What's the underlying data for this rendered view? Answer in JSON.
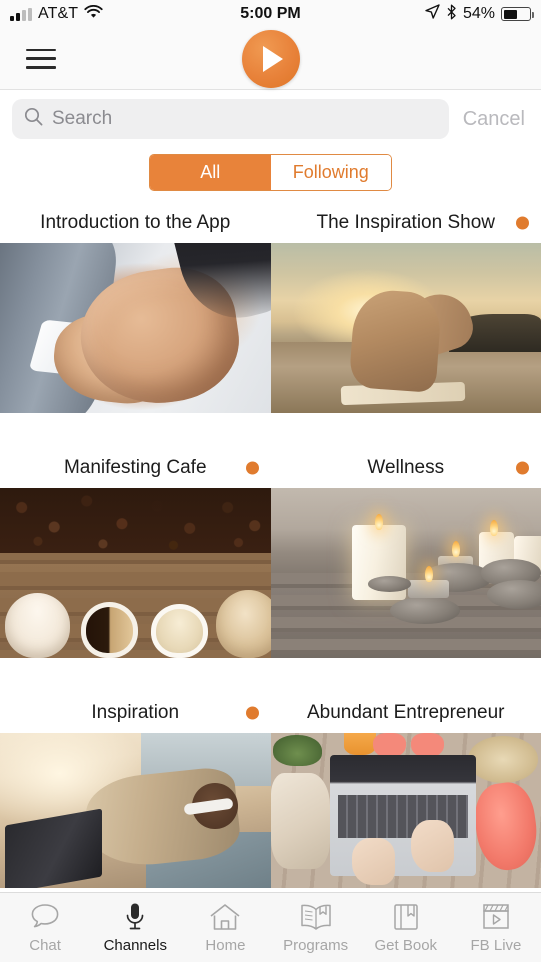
{
  "status_bar": {
    "carrier": "AT&T",
    "time": "5:00 PM",
    "battery_percent": "54%",
    "battery_level": 54,
    "icons": [
      "signal-bars-icon",
      "wifi-icon",
      "location-arrow-icon",
      "bluetooth-icon",
      "battery-icon"
    ]
  },
  "nav": {
    "menu_icon": "hamburger-menu-icon",
    "play_icon": "play-icon"
  },
  "search": {
    "placeholder": "Search",
    "value": "",
    "icon": "search-icon",
    "cancel_label": "Cancel"
  },
  "segmented": {
    "options": [
      {
        "label": "All",
        "selected": true
      },
      {
        "label": "Following",
        "selected": false
      }
    ]
  },
  "colors": {
    "accent_orange": "#e8833a",
    "dot_orange": "#e07b2e",
    "search_field_bg": "#efeff0",
    "cancel_gray": "#b9b9bd",
    "tab_inactive": "#a6a6a6",
    "tab_active": "#1a1a1a"
  },
  "channels": [
    {
      "title": "Introduction to the App",
      "has_dot": false,
      "image": "business-handshake-photo"
    },
    {
      "title": "The Inspiration Show",
      "has_dot": true,
      "image": "woman-on-beach-sunset-photo"
    },
    {
      "title": "Manifesting Cafe",
      "has_dot": true,
      "image": "coffee-beans-and-cups-photo"
    },
    {
      "title": "Wellness",
      "has_dot": true,
      "image": "spa-candles-and-stones-photo"
    },
    {
      "title": "Inspiration",
      "has_dot": true,
      "image": "woman-with-headphones-laptop-beach-photo"
    },
    {
      "title": "Abundant Entrepreneur",
      "has_dot": false,
      "image": "laptop-flatlay-desk-photo"
    }
  ],
  "tabbar": [
    {
      "label": "Chat",
      "icon": "chat-bubble-icon",
      "active": false
    },
    {
      "label": "Channels",
      "icon": "microphone-icon",
      "active": true
    },
    {
      "label": "Home",
      "icon": "home-icon",
      "active": false
    },
    {
      "label": "Programs",
      "icon": "open-book-icon",
      "active": false
    },
    {
      "label": "Get Book",
      "icon": "book-bookmark-icon",
      "active": false
    },
    {
      "label": "FB Live",
      "icon": "clapperboard-play-icon",
      "active": false
    }
  ]
}
